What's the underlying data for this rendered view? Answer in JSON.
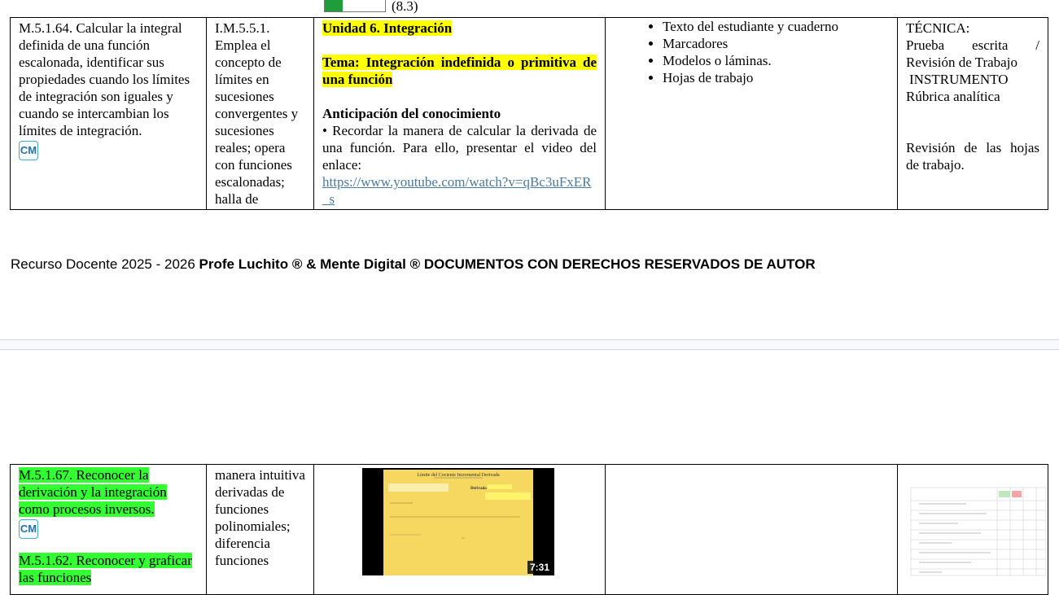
{
  "top_fragment": {
    "label": "(8.3)"
  },
  "row1": {
    "criterio": "M.5.1.64. Calcular la integral definida de una función escalonada, identificar sus propiedades cuando los límites de integración son iguales y cuando se intercambian los límites de integración.",
    "cm_badge": "CM",
    "indicador": "I.M.5.5.1. Emplea el concepto de límites en sucesiones convergentes y sucesiones reales; opera con funciones escalonadas; halla de",
    "unidad": "Unidad 6. Integración",
    "tema": "Tema: Integración indefinida o primitiva de una función",
    "anticipacion_title": "Anticipación del conocimiento",
    "anticipacion_text": "• Recordar la manera de calcular la derivada de una función. Para ello, presentar el video del enlace:",
    "link": "https://www.youtube.com/watch?v=qBc3uFxER_s",
    "recursos": [
      "Texto del estudiante y cuaderno",
      "Marcadores",
      "Modelos o láminas.",
      "Hojas de trabajo"
    ],
    "evaluacion": {
      "tecnica_label": "TÉCNICA:",
      "tecnica": "Prueba escrita / Revisión de Trabajo",
      "instrumento_label": "INSTRUMENTO",
      "instrumento": "Rúbrica analítica",
      "revision": "Revisión de las hojas de trabajo."
    }
  },
  "footer": {
    "prefix": "Recurso Docente 2025 - 2026",
    "bold": "Profe Luchito ® & Mente Digital ® DOCUMENTOS CON DERECHOS RESERVADOS DE AUTOR"
  },
  "row2": {
    "criterio_a": "M.5.1.67. Reconocer la derivación y la integración como procesos inversos.",
    "cm_badge": "CM",
    "criterio_b": "M.5.1.62. Reconocer y graficar las funciones",
    "indicador": "manera intuitiva derivadas de funciones polinomiales; diferencia funciones",
    "video": {
      "slide_title": "Límite del Cociente Incremental  Derivada",
      "slide_label": "Derivada de",
      "duration": "7:31"
    }
  },
  "colors": {
    "highlight_yellow": "#ffff00",
    "highlight_green": "#33ff33",
    "link": "#4a7aa0",
    "video_slide": "#f6d860"
  }
}
